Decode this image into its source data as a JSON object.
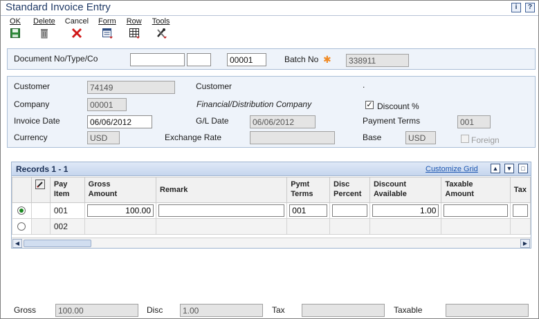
{
  "window": {
    "title": "Standard Invoice Entry",
    "info_icon": "i",
    "help_icon": "?"
  },
  "toolbar": {
    "items": [
      {
        "label": "OK",
        "icon": "save-icon"
      },
      {
        "label": "Delete",
        "icon": "trash-icon"
      },
      {
        "label": "Cancel",
        "icon": "close-icon"
      },
      {
        "label": "Form",
        "icon": "form-icon"
      },
      {
        "label": "Row",
        "icon": "grid-icon"
      },
      {
        "label": "Tools",
        "icon": "tools-icon"
      }
    ]
  },
  "header": {
    "doc_label": "Document No/Type/Co",
    "doc_no": "",
    "doc_type": "",
    "doc_co": "00001",
    "batch_label": "Batch No",
    "batch_no": "338911"
  },
  "details": {
    "customer_label": "Customer",
    "customer_value": "74149",
    "customer_label2": "Customer",
    "customer_name": ".",
    "company_label": "Company",
    "company_value": "00001",
    "company_name": "Financial/Distribution Company",
    "discount_label": "Discount %",
    "discount_checked": true,
    "invoice_date_label": "Invoice Date",
    "invoice_date": "06/06/2012",
    "gl_date_label": "G/L Date",
    "gl_date": "06/06/2012",
    "payment_terms_label": "Payment Terms",
    "payment_terms": "001",
    "currency_label": "Currency",
    "currency": "USD",
    "exchange_rate_label": "Exchange Rate",
    "exchange_rate": "",
    "base_label": "Base",
    "base": "USD",
    "foreign_label": "Foreign",
    "foreign_checked": false
  },
  "grid": {
    "title": "Records 1 - 1",
    "customize_label": "Customize Grid",
    "columns": {
      "pay_item": [
        "Pay",
        "Item"
      ],
      "gross": [
        "Gross",
        "Amount"
      ],
      "remark": [
        "Remark"
      ],
      "pymt": [
        "Pymt",
        "Terms"
      ],
      "disc": [
        "Disc",
        "Percent"
      ],
      "discount": [
        "Discount",
        "Available"
      ],
      "taxable": [
        "Taxable",
        "Amount"
      ],
      "tax": [
        "Tax"
      ]
    },
    "rows": [
      {
        "pay_item": "001",
        "gross": "100.00",
        "remark": "",
        "pymt": "001",
        "disc": "",
        "discount": "1.00",
        "taxable": "",
        "selected": true
      },
      {
        "pay_item": "002",
        "gross": "",
        "remark": "",
        "pymt": "",
        "disc": "",
        "discount": "",
        "taxable": "",
        "selected": false
      }
    ]
  },
  "totals": {
    "gross_label": "Gross",
    "gross": "100.00",
    "disc_label": "Disc",
    "disc": "1.00",
    "tax_label": "Tax",
    "tax": "",
    "taxable_label": "Taxable",
    "taxable": ""
  }
}
